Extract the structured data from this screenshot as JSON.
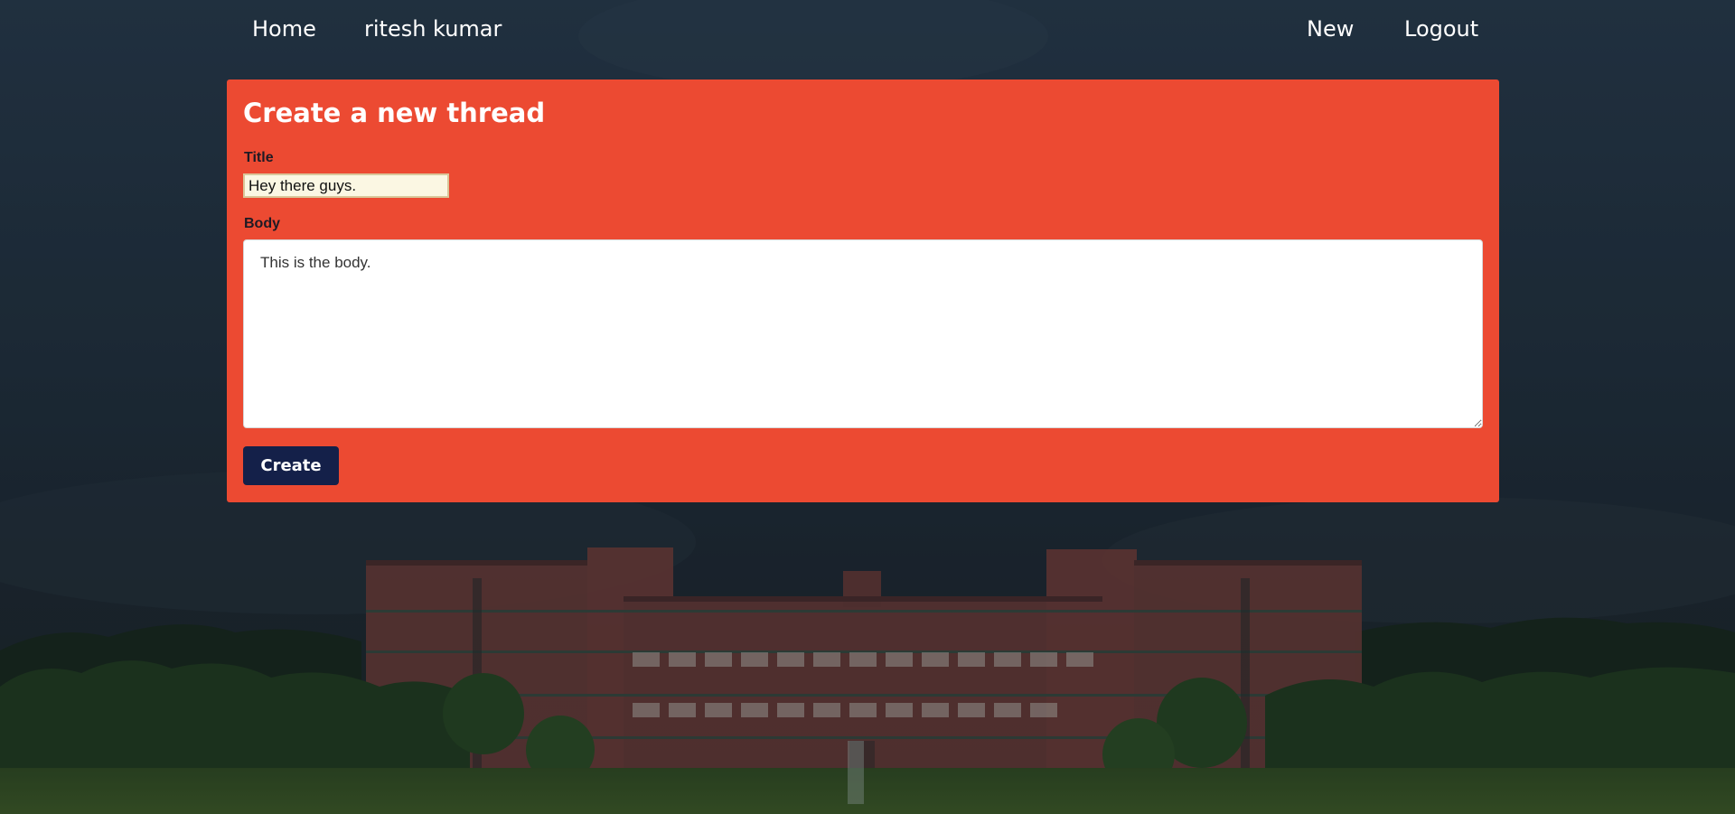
{
  "nav": {
    "home_label": "Home",
    "user_label": "ritesh kumar",
    "new_label": "New",
    "logout_label": "Logout"
  },
  "form": {
    "heading": "Create a new thread",
    "title_label": "Title",
    "title_value": "Hey there guys.",
    "body_label": "Body",
    "body_value": "This is the body.",
    "submit_label": "Create"
  },
  "colors": {
    "card_background": "#ec4a32",
    "button_background": "#142049",
    "page_background": "#22313f"
  }
}
